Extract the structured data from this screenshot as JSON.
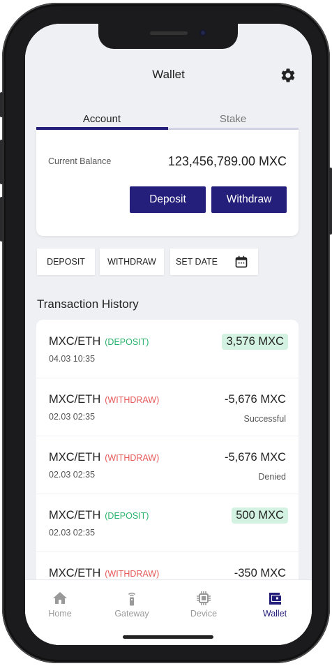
{
  "header": {
    "title": "Wallet",
    "settings_icon": "gear-icon"
  },
  "tabs": [
    {
      "label": "Account",
      "active": true
    },
    {
      "label": "Stake",
      "active": false
    }
  ],
  "balance": {
    "label": "Current Balance",
    "value": "123,456,789.00 MXC",
    "deposit_label": "Deposit",
    "withdraw_label": "Withdraw"
  },
  "filters": {
    "deposit": "DEPOSIT",
    "withdraw": "WITHDRAW",
    "set_date": "SET DATE",
    "calendar_icon": "calendar-icon"
  },
  "history": {
    "title": "Transaction History",
    "transactions": [
      {
        "pair": "MXC/ETH",
        "type": "(DEPOSIT)",
        "date": "04.03 10:35",
        "amount": "3,576 MXC",
        "status": ""
      },
      {
        "pair": "MXC/ETH",
        "type": "(WITHDRAW)",
        "date": "02.03 02:35",
        "amount": "-5,676 MXC",
        "status": "Successful"
      },
      {
        "pair": "MXC/ETH",
        "type": "(WITHDRAW)",
        "date": "02.03 02:35",
        "amount": "-5,676 MXC",
        "status": "Denied"
      },
      {
        "pair": "MXC/ETH",
        "type": "(DEPOSIT)",
        "date": "02.03 02:35",
        "amount": "500 MXC",
        "status": ""
      },
      {
        "pair": "MXC/ETH",
        "type": "(WITHDRAW)",
        "date": "",
        "amount": "-350 MXC",
        "status": ""
      }
    ]
  },
  "nav": [
    {
      "label": "Home",
      "icon": "home-icon"
    },
    {
      "label": "Gateway",
      "icon": "gateway-icon"
    },
    {
      "label": "Device",
      "icon": "chip-icon"
    },
    {
      "label": "Wallet",
      "icon": "wallet-icon",
      "active": true
    }
  ],
  "colors": {
    "accent": "#241f7a",
    "deposit": "#2bb36b",
    "withdraw": "#e55a5a",
    "background": "#eef0f4"
  }
}
